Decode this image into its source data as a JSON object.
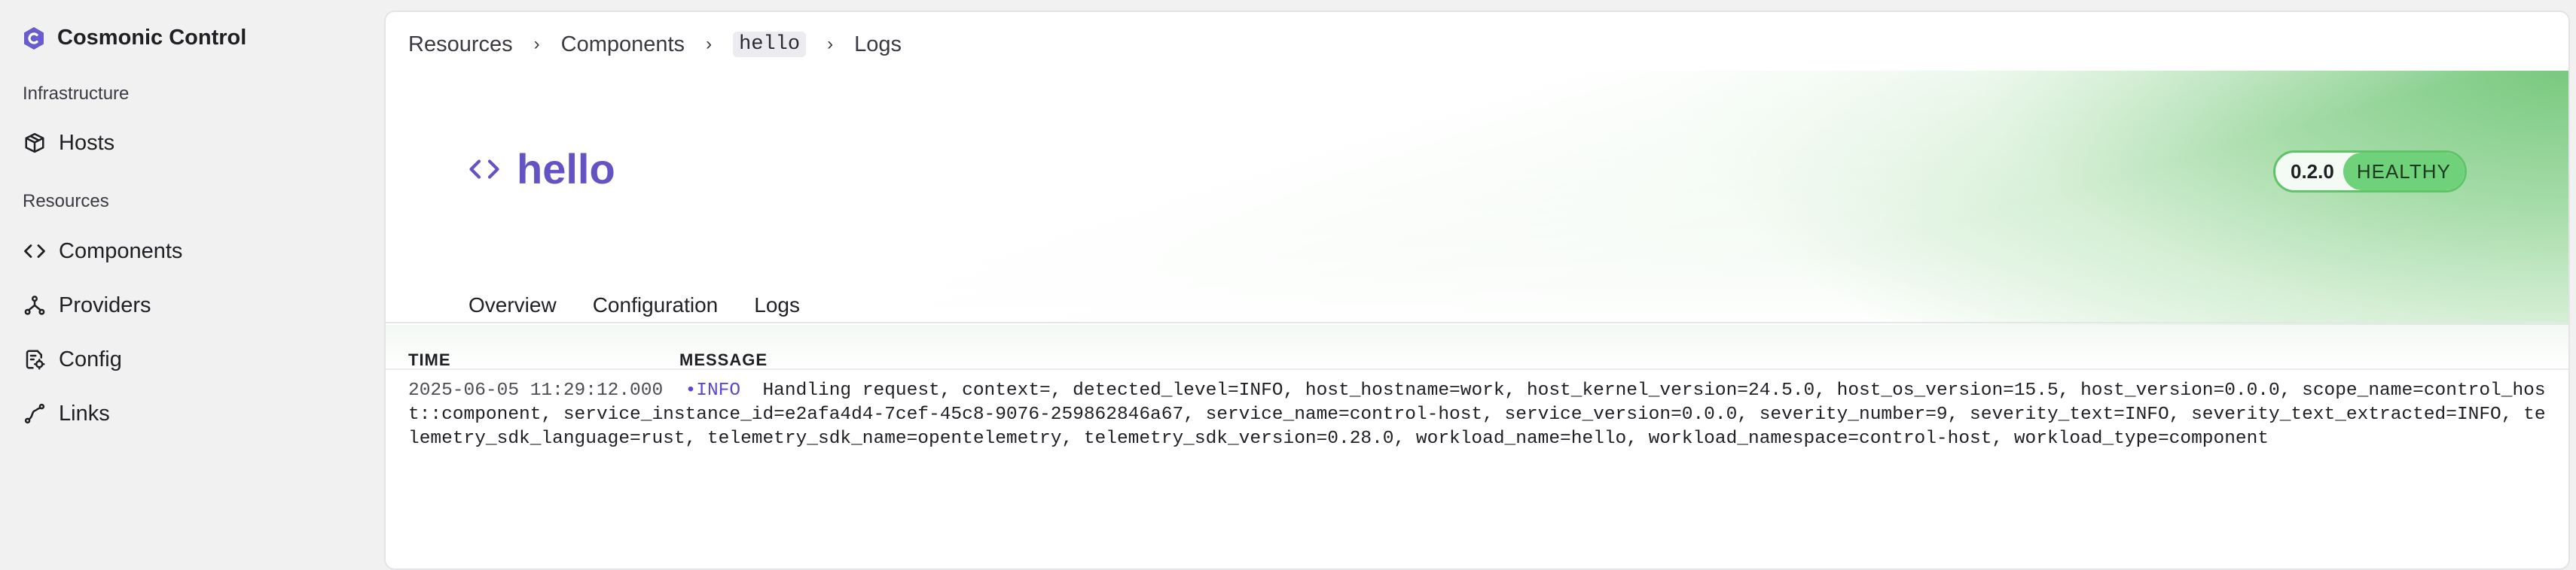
{
  "sidebar": {
    "brand": "Cosmonic Control",
    "sections": [
      {
        "label": "Infrastructure"
      },
      {
        "label": "Resources"
      }
    ],
    "items": [
      {
        "label": "Hosts",
        "icon": "cube-icon"
      },
      {
        "label": "Components",
        "icon": "code-icon"
      },
      {
        "label": "Providers",
        "icon": "fork-icon"
      },
      {
        "label": "Config",
        "icon": "config-icon"
      },
      {
        "label": "Links",
        "icon": "link-icon"
      }
    ]
  },
  "breadcrumb": {
    "items": [
      "Resources",
      "Components",
      "hello",
      "Logs"
    ]
  },
  "header": {
    "title": "hello",
    "version": "0.2.0",
    "status": "HEALTHY"
  },
  "tabs": [
    {
      "label": "Overview"
    },
    {
      "label": "Configuration"
    },
    {
      "label": "Logs",
      "active": true
    }
  ],
  "logs": {
    "columns": {
      "time": "TIME",
      "message": "MESSAGE"
    },
    "rows": [
      {
        "time": "2025-06-05 11:29:12.000",
        "level": "INFO",
        "message": "Handling request, context=, detected_level=INFO, host_hostname=work, host_kernel_version=24.5.0, host_os_version=15.5, host_version=0.0.0, scope_name=control_host::component, service_instance_id=e2afa4d4-7cef-45c8-9076-259862846a67, service_name=control-host, service_version=0.0.0, severity_number=9, severity_text=INFO, severity_text_extracted=INFO, telemetry_sdk_language=rust, telemetry_sdk_name=opentelemetry, telemetry_sdk_version=0.28.0, workload_name=hello, workload_namespace=control-host, workload_type=component"
      }
    ]
  },
  "colors": {
    "accent": "#6453c4",
    "healthy": "#6fd17a",
    "healthy_border": "#5fc467"
  }
}
